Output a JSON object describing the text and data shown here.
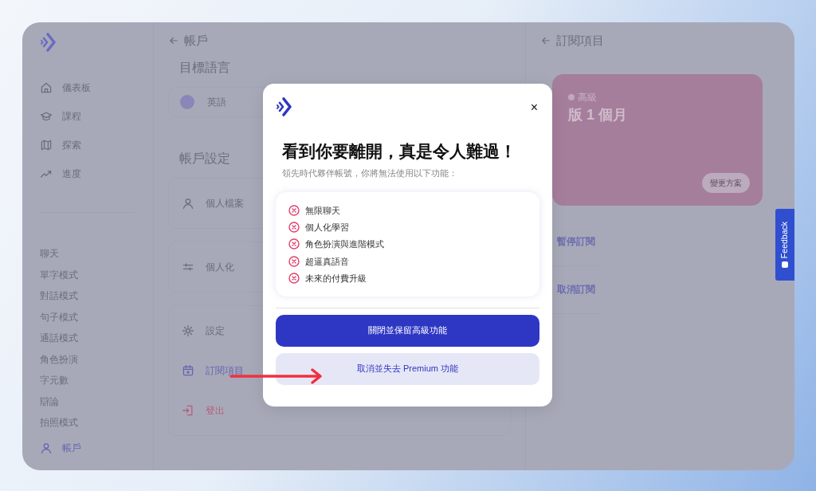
{
  "sidebar": {
    "nav": [
      {
        "label": "儀表板",
        "selected": false
      },
      {
        "label": "課程",
        "selected": false
      },
      {
        "label": "探索",
        "selected": false
      },
      {
        "label": "進度",
        "selected": false
      }
    ],
    "modes": [
      "聊天",
      "單字模式",
      "對話模式",
      "句子模式",
      "通話模式",
      "角色扮演",
      "字元數",
      "辯論",
      "拍照模式"
    ],
    "account": {
      "label": "帳戶",
      "selected": true
    }
  },
  "account_panel": {
    "title": "帳戶",
    "language_heading": "目標語言",
    "language": "英語",
    "settings_heading": "帳戶設定",
    "settings": [
      {
        "title": "個人檔案",
        "kind": "normal",
        "selected": false
      },
      {
        "title": "個人化",
        "kind": "normal",
        "selected": false
      },
      {
        "title": "設定",
        "kind": "normal",
        "selected": false
      },
      {
        "title": "訂閱項目",
        "kind": "normal",
        "selected": true
      },
      {
        "title": "登出",
        "kind": "danger",
        "selected": false
      }
    ]
  },
  "subscription_panel": {
    "title": "訂閱項目",
    "plan_badge": "高級",
    "plan_name": "版 1 個月",
    "change_button": "變更方案",
    "actions": [
      "暫停訂閱",
      "取消訂閱"
    ]
  },
  "dialog": {
    "close": "×",
    "title": "看到你要離開，真是令人難過！",
    "subtitle": "領先時代夥伴帳號，你將無法使用以下功能：",
    "features": [
      "無限聊天",
      "個人化學習",
      "角色扮演與進階模式",
      "超逼真語音",
      "未來的付費升級"
    ],
    "buttons": [
      {
        "label": "關閉並保留高級功能",
        "kind": "primary"
      },
      {
        "label": "取消並失去 Premium 功能",
        "kind": "secondary"
      }
    ]
  },
  "feedback_tab": "Feedback"
}
